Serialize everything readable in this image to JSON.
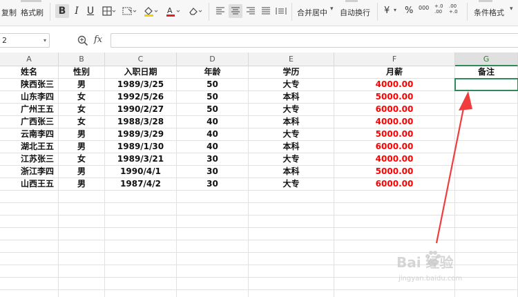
{
  "toolbar": {
    "copy_label": "复制",
    "format_painter_label": "格式刷",
    "bold": "B",
    "italic": "I",
    "underline": "U",
    "merge_center_label": "合并居中",
    "wrap_text_label": "自动换行",
    "currency_symbol": "¥",
    "percent_symbol": "%",
    "thousands_symbol": "000",
    "increase_decimal_symbol": "+.0 .00",
    "decrease_decimal_symbol": ".00 +.0",
    "conditional_format_label": "条件格式"
  },
  "formula_bar": {
    "name_box": "2",
    "fx_label": "fx",
    "formula": ""
  },
  "columns": [
    "A",
    "B",
    "C",
    "D",
    "E",
    "F",
    "G"
  ],
  "selected_column": "G",
  "header_row": [
    "姓名",
    "性别",
    "入职日期",
    "年龄",
    "学历",
    "月薪",
    "备注"
  ],
  "rows": [
    [
      "陕西张三",
      "男",
      "1989/3/25",
      "50",
      "大专",
      "4000.00",
      ""
    ],
    [
      "山东李四",
      "女",
      "1992/5/26",
      "50",
      "本科",
      "5000.00",
      ""
    ],
    [
      "广州王五",
      "女",
      "1990/2/27",
      "50",
      "大专",
      "6000.00",
      ""
    ],
    [
      "广西张三",
      "女",
      "1988/3/28",
      "40",
      "本科",
      "4000.00",
      ""
    ],
    [
      "云南李四",
      "男",
      "1989/3/29",
      "40",
      "大专",
      "5000.00",
      ""
    ],
    [
      "湖北王五",
      "男",
      "1989/1/30",
      "40",
      "本科",
      "6000.00",
      ""
    ],
    [
      "江苏张三",
      "女",
      "1989/3/21",
      "30",
      "大专",
      "4000.00",
      ""
    ],
    [
      "浙江李四",
      "男",
      "1990/4/1",
      "30",
      "本科",
      "5000.00",
      ""
    ],
    [
      "山西王五",
      "男",
      "1987/4/2",
      "30",
      "大专",
      "6000.00",
      ""
    ]
  ],
  "selected_cell": "G2",
  "colors": {
    "salary_text": "#ff0000",
    "selection": "#2e8b57",
    "arrow": "#f03c3c"
  },
  "watermark": {
    "main": "Bai 经验",
    "sub": "jingyan.baidu.com"
  }
}
